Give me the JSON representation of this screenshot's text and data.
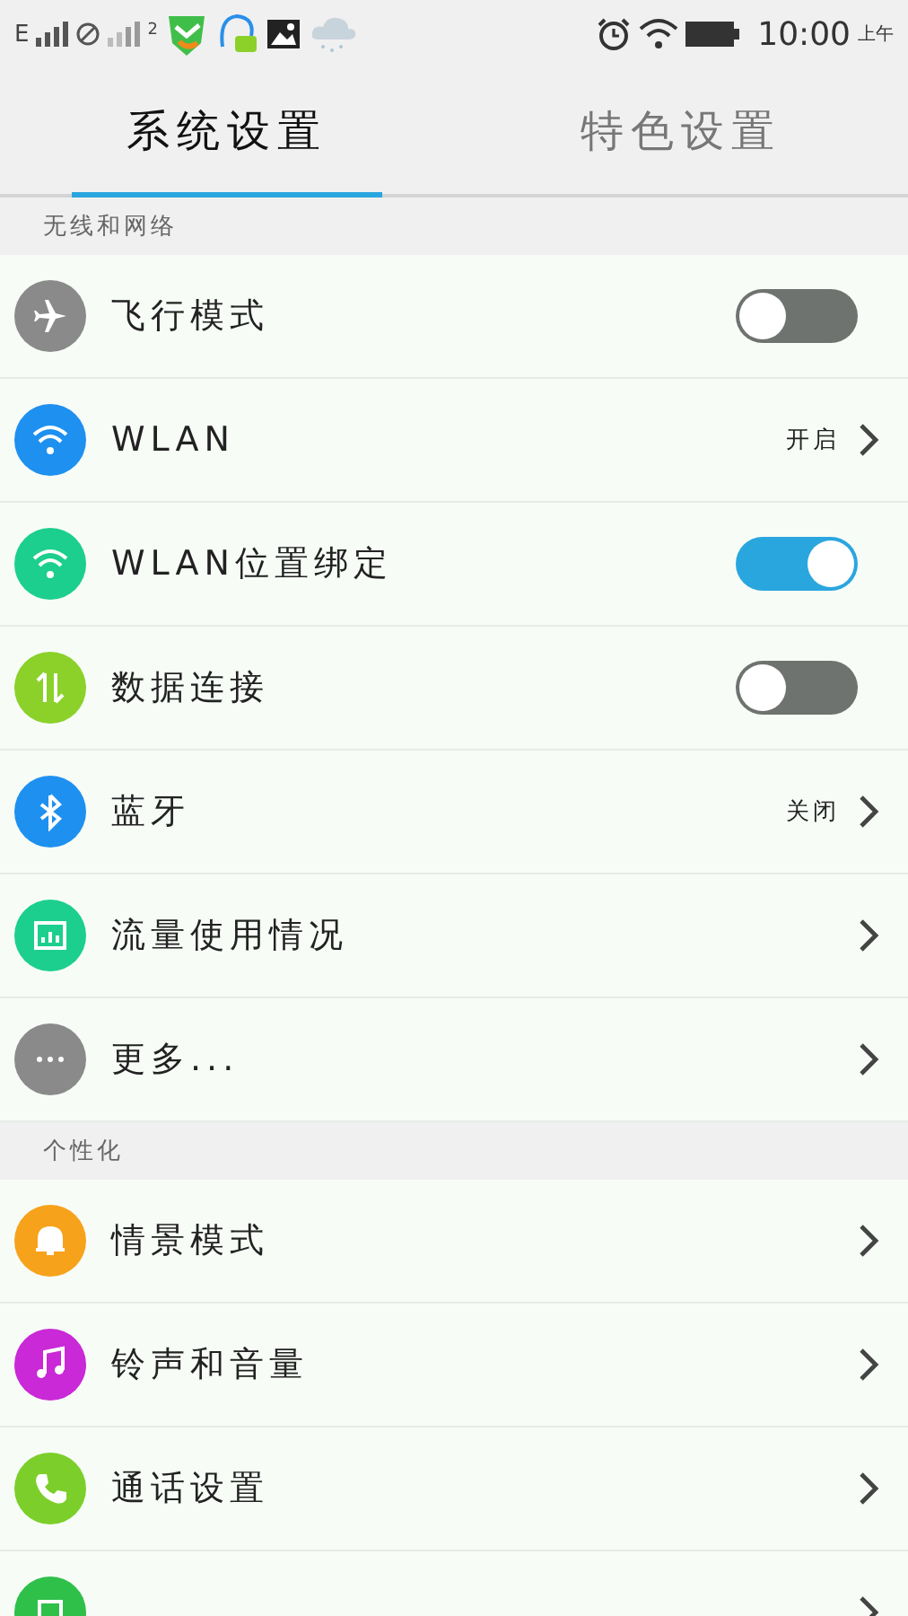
{
  "status_bar": {
    "network": "E",
    "sim2": "2",
    "time": "10:00",
    "ampm": "上午"
  },
  "tabs": [
    {
      "label": "系统设置",
      "selected": true
    },
    {
      "label": "特色设置",
      "selected": false
    }
  ],
  "sections": [
    {
      "header": "无线和网络",
      "items": [
        {
          "label": "飞行模式",
          "kind": "toggle",
          "on": false,
          "color": "#8a8a8a"
        },
        {
          "label": "WLAN",
          "kind": "link",
          "value": "开启",
          "color": "#1e90f0"
        },
        {
          "label": "WLAN位置绑定",
          "kind": "toggle",
          "on": true,
          "color": "#1ccf8e"
        },
        {
          "label": "数据连接",
          "kind": "toggle",
          "on": false,
          "color": "#8bd12a"
        },
        {
          "label": "蓝牙",
          "kind": "link",
          "value": "关闭",
          "color": "#1e90f0"
        },
        {
          "label": "流量使用情况",
          "kind": "link",
          "color": "#1ccf8e"
        },
        {
          "label": "更多...",
          "kind": "link",
          "color": "#8a8a8a"
        }
      ]
    },
    {
      "header": "个性化",
      "items": [
        {
          "label": "情景模式",
          "kind": "link",
          "color": "#f7a21b"
        },
        {
          "label": "铃声和音量",
          "kind": "link",
          "color": "#c929d6"
        },
        {
          "label": "通话设置",
          "kind": "link",
          "color": "#7ccf2a"
        },
        {
          "kind": "link",
          "color": "#2fc04a"
        }
      ]
    }
  ]
}
